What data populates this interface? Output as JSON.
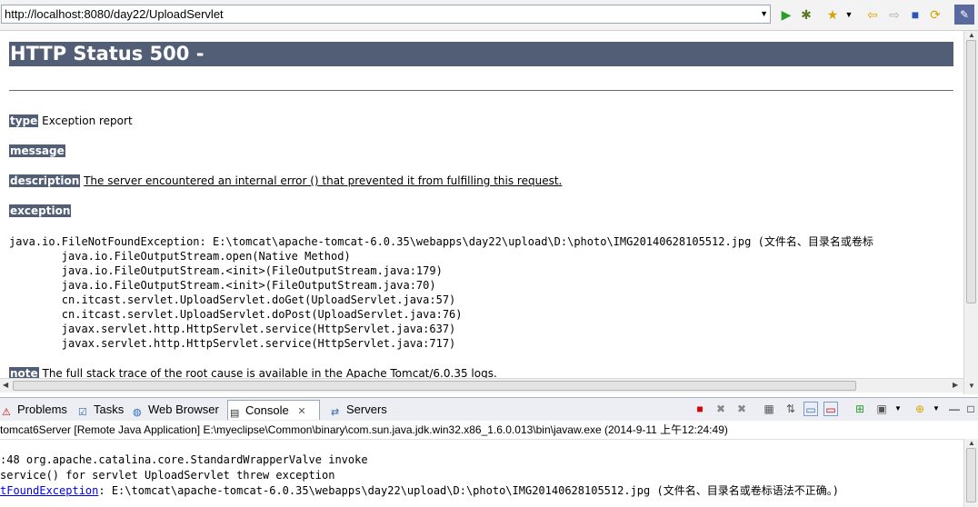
{
  "browser": {
    "url": "http://localhost:8080/day22/UploadServlet",
    "toolbar_icons": [
      "go-icon",
      "debug-icon",
      "favorite-icon",
      "back-icon",
      "forward-icon",
      "stop-icon",
      "refresh-icon"
    ]
  },
  "page": {
    "heading": "HTTP Status 500 -",
    "type_label": "type",
    "type_value": "Exception report",
    "message_label": "message",
    "description_label": "description",
    "description_value": "The server encountered an internal error () that prevented it from fulfilling this request.",
    "exception_label": "exception",
    "trace_first": "java.io.FileNotFoundException: E:\\tomcat\\apache-tomcat-6.0.35\\webapps\\day22\\upload\\D:\\photo\\IMG20140628105512.jpg (文件名、目录名或卷标",
    "trace_lines": [
      "java.io.FileOutputStream.open(Native Method)",
      "java.io.FileOutputStream.<init>(FileOutputStream.java:179)",
      "java.io.FileOutputStream.<init>(FileOutputStream.java:70)",
      "cn.itcast.servlet.UploadServlet.doGet(UploadServlet.java:57)",
      "cn.itcast.servlet.UploadServlet.doPost(UploadServlet.java:76)",
      "javax.servlet.http.HttpServlet.service(HttpServlet.java:637)",
      "javax.servlet.http.HttpServlet.service(HttpServlet.java:717)"
    ],
    "note_label": "note",
    "note_value": "The full stack trace of the root cause is available in the Apache Tomcat/6.0.35 logs."
  },
  "tabs": [
    {
      "label": "Problems"
    },
    {
      "label": "Tasks"
    },
    {
      "label": "Web Browser"
    },
    {
      "label": "Console"
    },
    {
      "label": "Servers"
    }
  ],
  "console": {
    "header": "tomcat6Server [Remote Java Application] E:\\myeclipse\\Common\\binary\\com.sun.java.jdk.win32.x86_1.6.0.013\\bin\\javaw.exe (2014-9-11 上午12:24:49)",
    "line1": ":48 org.apache.catalina.core.StandardWrapperValve invoke",
    "line2": "service() for servlet UploadServlet threw exception",
    "line3_link": "tFoundException",
    "line3_rest": ": E:\\tomcat\\apache-tomcat-6.0.35\\webapps\\day22\\upload\\D:\\photo\\IMG20140628105512.jpg (文件名、目录名或卷标语法不正确。)"
  }
}
